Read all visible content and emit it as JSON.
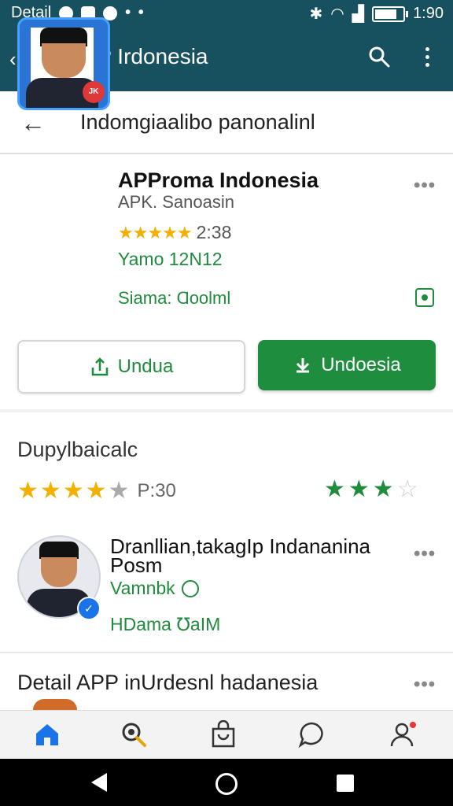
{
  "statusbar": {
    "carrier": "Detail",
    "time": "1:90"
  },
  "appbar": {
    "title": "APP Irdonesia"
  },
  "crumb": {
    "text": "Indomgiaalibo panonalinl"
  },
  "app": {
    "name": "APProma Indonesia",
    "sub": "APK. Sanoasin",
    "rating_value": "2:38",
    "stars": "★★★★★",
    "version": "Yamo 12N12",
    "size": "Siama: Ɑoolml",
    "badge": "JK"
  },
  "buttons": {
    "outline_label": "Undua",
    "fill_label": "Undoesia"
  },
  "section": {
    "title": "Dupylbaicalc",
    "rating_label": "P:30"
  },
  "developer": {
    "name": "Dranllian,takagIp Indananina Posm",
    "sub": "Vamnbk",
    "meta": "HDama ℧aIM"
  },
  "detail": {
    "title": "Detail APP inUrdesnl hadanesia"
  },
  "colors": {
    "header": "#17505f",
    "green": "#1e8d3e",
    "star": "#f2b000",
    "blue_accent": "#1a73e8"
  },
  "nav": {
    "items": [
      "home-icon",
      "search-icon",
      "bag-icon",
      "chat-icon",
      "user-icon"
    ]
  }
}
